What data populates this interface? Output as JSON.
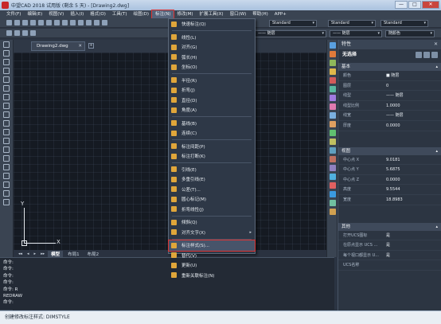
{
  "window": {
    "title": "中望CAD 2018 试用版 (剩余 5 天) - [Drawing2.dwg]",
    "buttons": [
      "—",
      "□",
      "✕"
    ]
  },
  "menubar": {
    "items": [
      {
        "label": "文件(F)"
      },
      {
        "label": "编辑(E)"
      },
      {
        "label": "视图(V)"
      },
      {
        "label": "插入(I)"
      },
      {
        "label": "格式(O)"
      },
      {
        "label": "工具(T)"
      },
      {
        "label": "绘图(D)"
      },
      {
        "label": "标注(N)"
      },
      {
        "label": "修改(M)"
      },
      {
        "label": "扩展工具(X)"
      },
      {
        "label": "窗口(W)"
      },
      {
        "label": "帮助(H)"
      },
      {
        "label": "APP+"
      }
    ],
    "active_index": 7
  },
  "toolbar": {
    "style_combo_1": "Standard",
    "style_combo_2": "Standard",
    "style_combo_3": "Standard",
    "layer_combo_1": "—— 随层",
    "layer_combo_2": "—— 随层",
    "layer_combo_3": "随颜色"
  },
  "document_tab": {
    "label": "Drawing2.dwg",
    "close": "✕",
    "new": "+"
  },
  "dimension_menu": {
    "items": [
      {
        "label": "快速标注(Q)",
        "sep_after": true
      },
      {
        "label": "线性(L)"
      },
      {
        "label": "对齐(G)"
      },
      {
        "label": "弧长(H)"
      },
      {
        "label": "坐标(O)",
        "sep_after": true
      },
      {
        "label": "半径(R)"
      },
      {
        "label": "折弯(J)"
      },
      {
        "label": "直径(D)"
      },
      {
        "label": "角度(A)",
        "sep_after": true
      },
      {
        "label": "基线(B)"
      },
      {
        "label": "连续(C)",
        "sep_after": true
      },
      {
        "label": "标注间距(P)"
      },
      {
        "label": "标注打断(K)",
        "sep_after": true
      },
      {
        "label": "引线(E)"
      },
      {
        "label": "多重引线(E)"
      },
      {
        "label": "公差(T)..."
      },
      {
        "label": "圆心标记(M)"
      },
      {
        "label": "折弯线性(J)",
        "sep_after": true
      },
      {
        "label": "倾斜(Q)"
      },
      {
        "label": "对齐文字(X)",
        "has_submenu": true,
        "sep_after": true
      },
      {
        "label": "标注样式(S)...",
        "highlight": true
      },
      {
        "label": "替代(V)"
      },
      {
        "label": "更新(U)"
      },
      {
        "label": "重新关联标注(N)"
      }
    ],
    "submenu_arrow": "▸"
  },
  "ucs": {
    "y_label": "Y",
    "x_label": "X"
  },
  "layout_tabs": {
    "nav": [
      "◂◂",
      "◂",
      "▸",
      "▸▸"
    ],
    "tabs": [
      {
        "label": "模型"
      },
      {
        "label": "布局1"
      },
      {
        "label": "布局2"
      }
    ],
    "active_index": 0
  },
  "command": {
    "lines": [
      "命令:",
      "命令:",
      "命令:",
      "命令:",
      "命令: R",
      "REDRAW",
      "命令:"
    ]
  },
  "statusbar": {
    "text": "创建修改标注样式: DIMSTYLE"
  },
  "properties": {
    "title": "特性",
    "close": "✕",
    "selection": "无选择",
    "sections": [
      {
        "title": "基本",
        "rows": [
          {
            "key": "颜色",
            "value": "■ 随层"
          },
          {
            "key": "图层",
            "value": "0"
          },
          {
            "key": "线型",
            "value": "—— 随层"
          },
          {
            "key": "线型比例",
            "value": "1.0000"
          },
          {
            "key": "线宽",
            "value": "—— 随层"
          },
          {
            "key": "厚度",
            "value": "0.0000"
          }
        ]
      },
      {
        "title": "视图",
        "rows": [
          {
            "key": "中心点 X",
            "value": "9.0181"
          },
          {
            "key": "中心点 Y",
            "value": "5.6875"
          },
          {
            "key": "中心点 Z",
            "value": "0.0000"
          },
          {
            "key": "高度",
            "value": "9.5544"
          },
          {
            "key": "宽度",
            "value": "18.8983"
          }
        ]
      },
      {
        "title": "其他",
        "rows": [
          {
            "key": "打开UCS图标",
            "value": "是"
          },
          {
            "key": "在原点显示 UCS ...",
            "value": "是"
          },
          {
            "key": "每个视口都显示 U...",
            "value": "是"
          },
          {
            "key": "UCS名称",
            "value": ""
          }
        ]
      }
    ]
  }
}
